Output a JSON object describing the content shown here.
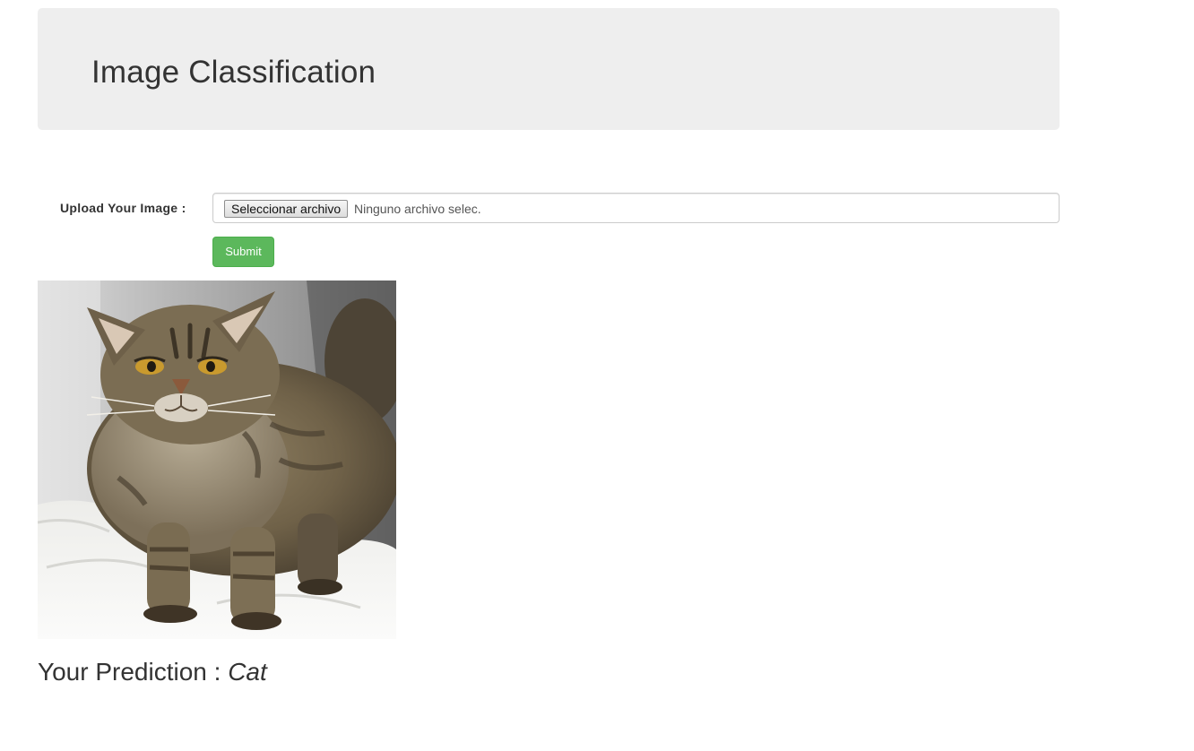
{
  "header": {
    "title": "Image Classification"
  },
  "upload_form": {
    "label": "Upload Your Image :",
    "file_button_label": "Seleccionar archivo",
    "file_status": "Ninguno archivo selec.",
    "submit_label": "Submit"
  },
  "image": {
    "subject": "cat photo"
  },
  "result": {
    "prefix": "Your Prediction : ",
    "value": "Cat"
  },
  "colors": {
    "header_bg": "#eeeeee",
    "submit_bg": "#5cb85c",
    "text": "#333333"
  }
}
